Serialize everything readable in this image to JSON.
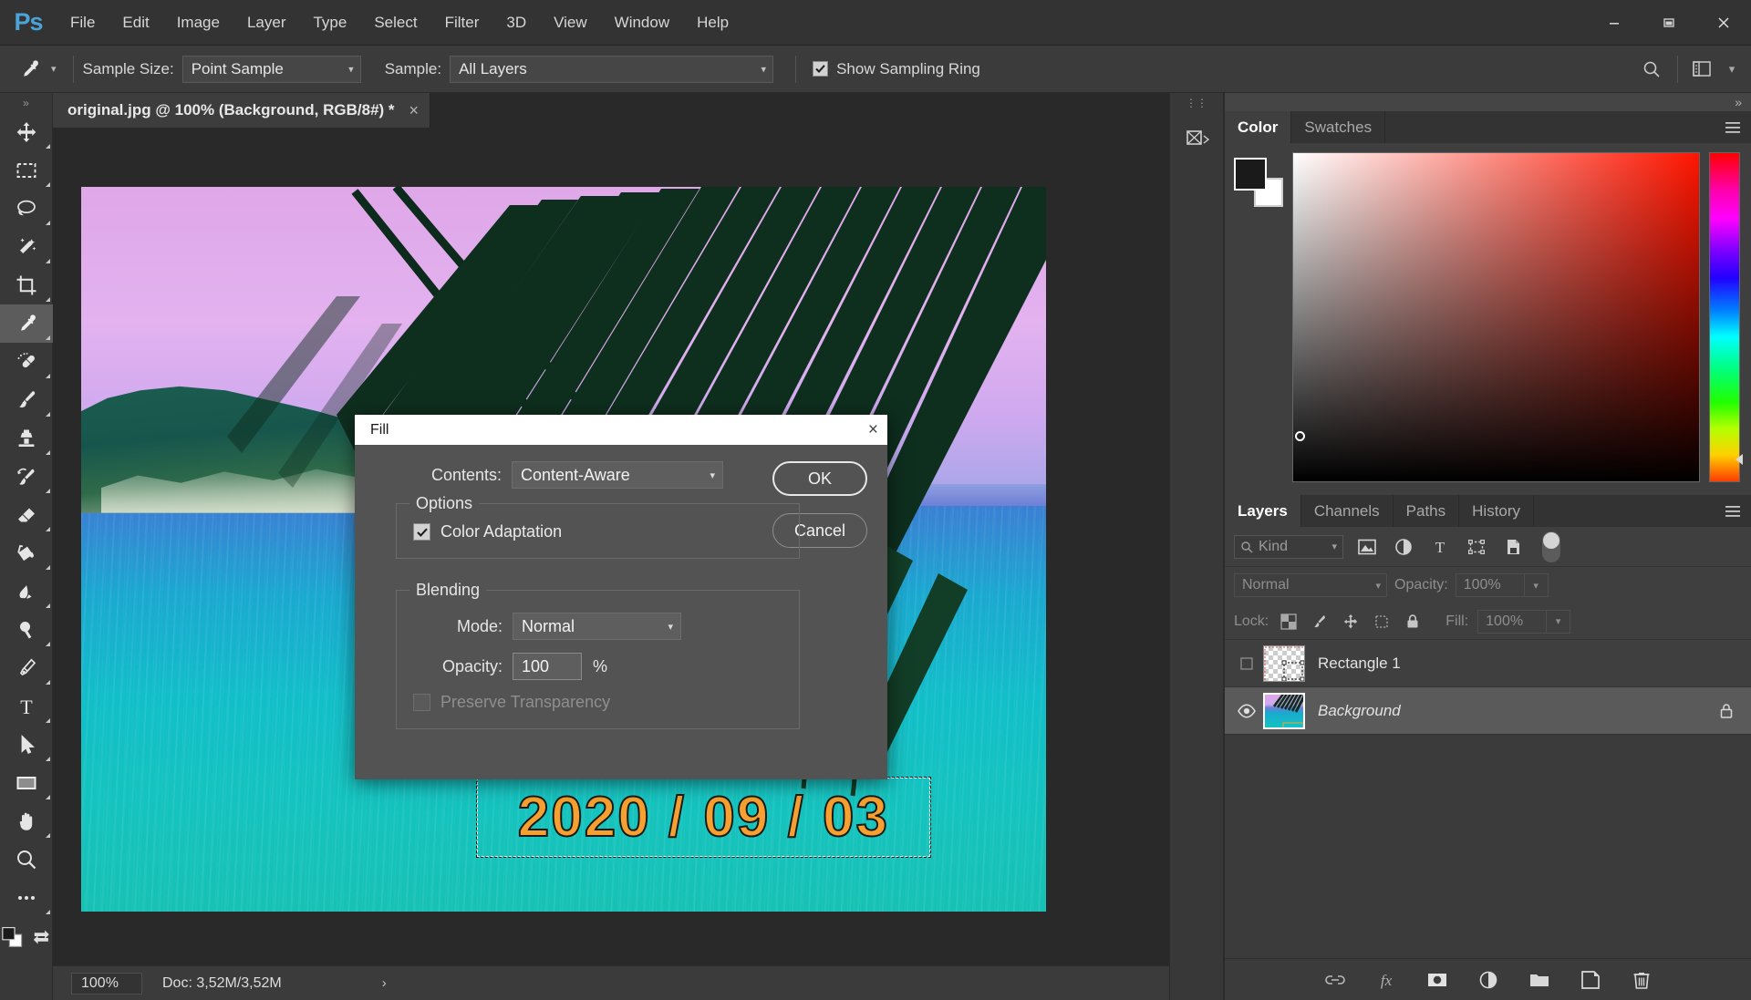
{
  "app": {
    "logo": "Ps",
    "menus": [
      "File",
      "Edit",
      "Image",
      "Layer",
      "Type",
      "Select",
      "Filter",
      "3D",
      "View",
      "Window",
      "Help"
    ],
    "window_controls": {
      "minimize": "minimize-icon",
      "maximize": "maximize-icon",
      "close": "close-icon"
    }
  },
  "options_bar": {
    "tool_icon": "eyedropper-icon",
    "sample_size_label": "Sample Size:",
    "sample_size_value": "Point Sample",
    "sample_label": "Sample:",
    "sample_value": "All Layers",
    "show_sampling_ring_label": "Show Sampling Ring",
    "show_sampling_ring_checked": true,
    "right_icons": [
      "search-icon",
      "workspace-icon",
      "chevron-down-icon"
    ]
  },
  "toolbar": {
    "tools": [
      {
        "name": "move-tool",
        "active": false
      },
      {
        "name": "rectangular-marquee-tool",
        "active": false
      },
      {
        "name": "lasso-tool",
        "active": false
      },
      {
        "name": "magic-wand-tool",
        "active": false
      },
      {
        "name": "crop-tool",
        "active": false
      },
      {
        "name": "eyedropper-tool",
        "active": true
      },
      {
        "name": "spot-healing-brush-tool",
        "active": false
      },
      {
        "name": "brush-tool",
        "active": false
      },
      {
        "name": "clone-stamp-tool",
        "active": false
      },
      {
        "name": "history-brush-tool",
        "active": false
      },
      {
        "name": "eraser-tool",
        "active": false
      },
      {
        "name": "paint-bucket-tool",
        "active": false
      },
      {
        "name": "blur-tool",
        "active": false
      },
      {
        "name": "dodge-tool",
        "active": false
      },
      {
        "name": "pen-tool",
        "active": false
      },
      {
        "name": "type-tool",
        "active": false
      },
      {
        "name": "path-selection-tool",
        "active": false
      },
      {
        "name": "rectangle-tool",
        "active": false
      },
      {
        "name": "hand-tool",
        "active": false
      },
      {
        "name": "zoom-tool",
        "active": false
      },
      {
        "name": "edit-toolbar-tool",
        "active": false
      }
    ]
  },
  "document": {
    "tab_title": "original.jpg @ 100% (Background, RGB/8#) *",
    "close_label": "×",
    "canvas_date_text": "2020 / 09 / 03"
  },
  "status_bar": {
    "zoom": "100%",
    "doc_info": "Doc: 3,52M/3,52M",
    "arrow": "›"
  },
  "fill_dialog": {
    "title": "Fill",
    "close_label": "×",
    "contents_label": "Contents:",
    "contents_value": "Content-Aware",
    "ok_label": "OK",
    "cancel_label": "Cancel",
    "options_legend": "Options",
    "color_adaptation_label": "Color Adaptation",
    "color_adaptation_checked": true,
    "blending_legend": "Blending",
    "mode_label": "Mode:",
    "mode_value": "Normal",
    "opacity_label": "Opacity:",
    "opacity_value": "100",
    "percent_symbol": "%",
    "preserve_transparency_label": "Preserve Transparency",
    "preserve_transparency_checked": false
  },
  "color_panel": {
    "tabs": [
      {
        "label": "Color",
        "active": true
      },
      {
        "label": "Swatches",
        "active": false
      }
    ],
    "foreground_color": "#1a1a1a",
    "background_color": "#ffffff",
    "menu_icon": "hamburger-menu-icon"
  },
  "layers_panel": {
    "tabs": [
      {
        "label": "Layers",
        "active": true
      },
      {
        "label": "Channels",
        "active": false
      },
      {
        "label": "Paths",
        "active": false
      },
      {
        "label": "History",
        "active": false
      }
    ],
    "menu_icon": "hamburger-menu-icon",
    "filter_kind_label": "Kind",
    "filter_icons": [
      "image-filter-icon",
      "adjustment-filter-icon",
      "type-filter-icon",
      "shape-filter-icon",
      "smartobject-filter-icon"
    ],
    "blend_mode": "Normal",
    "opacity_label": "Opacity:",
    "opacity_value": "100%",
    "lock_label": "Lock:",
    "lock_icons": [
      "lock-transparent-pixels-icon",
      "lock-image-pixels-icon",
      "lock-position-icon",
      "lock-artboard-icon",
      "lock-all-icon"
    ],
    "fill_label": "Fill:",
    "fill_value": "100%",
    "layers": [
      {
        "name": "Rectangle 1",
        "visible": false,
        "selected": false,
        "locked": false,
        "italic": false,
        "thumb": "transparent-shape"
      },
      {
        "name": "Background",
        "visible": true,
        "selected": true,
        "locked": true,
        "italic": true,
        "thumb": "photo"
      }
    ],
    "footer_icons": [
      "link-layers-icon",
      "layer-style-fx-icon",
      "add-layer-mask-icon",
      "adjustment-layer-icon",
      "new-group-icon",
      "new-layer-icon",
      "delete-layer-icon"
    ]
  },
  "mini_dock": {
    "icons": [
      "libraries-icon"
    ]
  }
}
